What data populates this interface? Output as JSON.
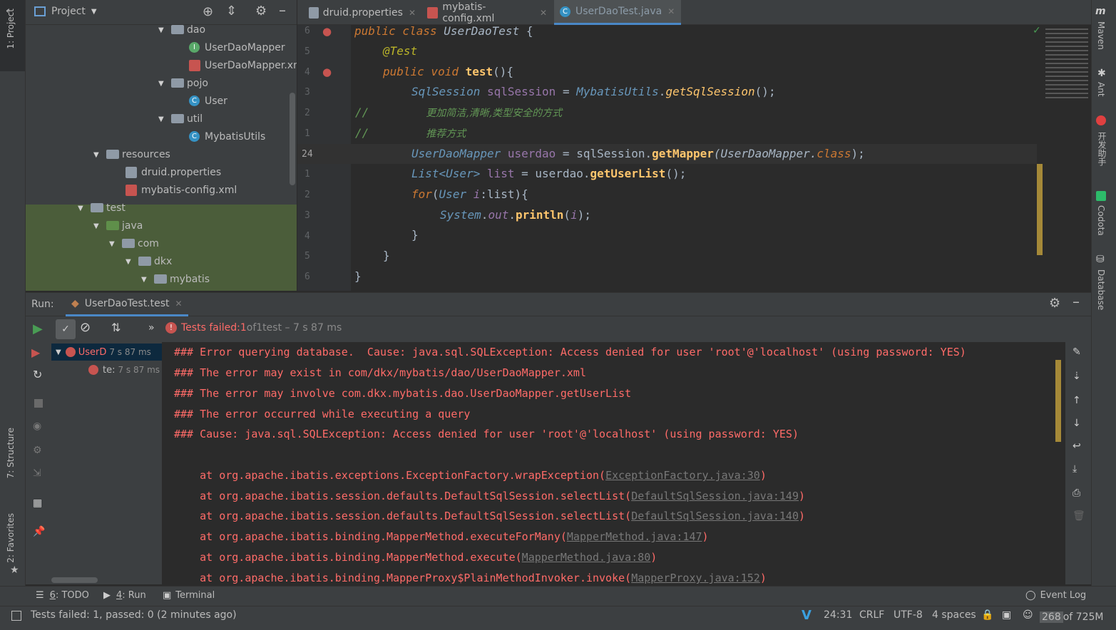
{
  "left_stripe": {
    "project": "1: Project",
    "structure": "7: Structure",
    "favorites": "2: Favorites"
  },
  "project_panel": {
    "title": "Project"
  },
  "tree": [
    {
      "label": "dao",
      "kind": "folder"
    },
    {
      "label": "UserDaoMapper",
      "kind": "interface"
    },
    {
      "label": "UserDaoMapper.xm",
      "kind": "xml"
    },
    {
      "label": "pojo",
      "kind": "folder"
    },
    {
      "label": "User",
      "kind": "class"
    },
    {
      "label": "util",
      "kind": "folder"
    },
    {
      "label": "MybatisUtils",
      "kind": "class"
    },
    {
      "label": "resources",
      "kind": "folder"
    },
    {
      "label": "druid.properties",
      "kind": "properties"
    },
    {
      "label": "mybatis-config.xml",
      "kind": "xml"
    },
    {
      "label": "test",
      "kind": "folder"
    },
    {
      "label": "java",
      "kind": "folder-green"
    },
    {
      "label": "com",
      "kind": "folder"
    },
    {
      "label": "dkx",
      "kind": "folder"
    },
    {
      "label": "mybatis",
      "kind": "folder"
    }
  ],
  "editor_tabs": [
    {
      "label": "druid.properties"
    },
    {
      "label": "mybatis-config.xml"
    },
    {
      "label": "UserDaoTest.java"
    }
  ],
  "line_numbers": [
    "6",
    "5",
    "4",
    "3",
    "2",
    "1",
    "24",
    "1",
    "2",
    "3",
    "4",
    "5",
    "6"
  ],
  "code": {
    "l1_kw": "public class ",
    "l1_name": "UserDaoTest ",
    "l1_brace": "{",
    "l2": "@Test",
    "l3_kw": "public void ",
    "l3_name": "test",
    "l3_rest": "(){",
    "l4_type": "SqlSession ",
    "l4_var": "sqlSession ",
    "l4_eq": "= ",
    "l4_cls": "MybatisUtils",
    "l4_dot": ".",
    "l4_m": "getSqlSession",
    "l4_end": "();",
    "l5_slash": "//",
    "l5_text": "更加简洁,清晰,类型安全的方式",
    "l6_slash": "//",
    "l6_text": "推荐方式",
    "l7_type": "UserDaoMapper ",
    "l7_var": "userdao ",
    "l7_eq": "= sqlSession.",
    "l7_m": "getMapper",
    "l7_arg": "(UserDaoMapper.",
    "l7_kw": "class",
    "l7_end": ");",
    "l8_type": "List",
    "l8_gen": "<User> ",
    "l8_var": "list ",
    "l8_eq": "= userdao.",
    "l8_m": "getUserList",
    "l8_end": "();",
    "l9_kw": "for",
    "l9_rest1": "(",
    "l9_type": "User ",
    "l9_var": "i",
    "l9_rest2": ":list){",
    "l10_cls": "System",
    "l10_dot": ".",
    "l10_out": "out",
    "l10_dot2": ".",
    "l10_m": "println",
    "l10_arg": "(",
    "l10_i": "i",
    "l10_end": ");",
    "l11": "}",
    "l12": "}",
    "l13": "}"
  },
  "right_stripe": {
    "maven": "Maven",
    "ant": "Ant",
    "helper": "开发助手",
    "codota": "Codota",
    "database": "Database"
  },
  "run_panel": {
    "label": "Run:",
    "tab": "UserDaoTest.test",
    "status_prefix": "Tests failed: ",
    "status_failed": "1",
    "status_mid": " of ",
    "status_total": "1",
    "status_suffix": " test – 7 s 87 ms",
    "tree_root": "UserD",
    "tree_root_time": "7 s 87 ms",
    "tree_child": "te:",
    "tree_child_time": "7 s 87 ms"
  },
  "console": {
    "lines": [
      "### Error querying database.  Cause: java.sql.SQLException: Access denied for user 'root'@'localhost' (using password: YES)",
      "### The error may exist in com/dkx/mybatis/dao/UserDaoMapper.xml",
      "### The error may involve com.dkx.mybatis.dao.UserDaoMapper.getUserList",
      "### The error occurred while executing a query",
      "### Cause: java.sql.SQLException: Access denied for user 'root'@'localhost' (using password: YES)"
    ],
    "stack": [
      {
        "text": "    at org.apache.ibatis.exceptions.ExceptionFactory.wrapException(",
        "link": "ExceptionFactory.java:30",
        "end": ")"
      },
      {
        "text": "    at org.apache.ibatis.session.defaults.DefaultSqlSession.selectList(",
        "link": "DefaultSqlSession.java:149",
        "end": ")"
      },
      {
        "text": "    at org.apache.ibatis.session.defaults.DefaultSqlSession.selectList(",
        "link": "DefaultSqlSession.java:140",
        "end": ")"
      },
      {
        "text": "    at org.apache.ibatis.binding.MapperMethod.executeForMany(",
        "link": "MapperMethod.java:147",
        "end": ")"
      },
      {
        "text": "    at org.apache.ibatis.binding.MapperMethod.execute(",
        "link": "MapperMethod.java:80",
        "end": ")"
      },
      {
        "text": "    at org.apache.ibatis.binding.MapperProxy$PlainMethodInvoker.invoke(",
        "link": "MapperProxy.java:152",
        "end": ")"
      }
    ]
  },
  "tool_strip": {
    "todo_num": "6",
    "todo": ": TODO",
    "run_num": "4",
    "run": ": Run",
    "terminal": "Terminal",
    "event_log": "Event Log"
  },
  "status_bar": {
    "message": "Tests failed: 1, passed: 0 (2 minutes ago)",
    "position": "24:31",
    "line_sep": "CRLF",
    "encoding": "UTF-8",
    "indent": "4 spaces",
    "memory_used": "268",
    "memory_total": " of 725M"
  },
  "colors": {
    "error": "#ff6b68",
    "accent_blue": "#3592c4",
    "green": "#499c54"
  }
}
